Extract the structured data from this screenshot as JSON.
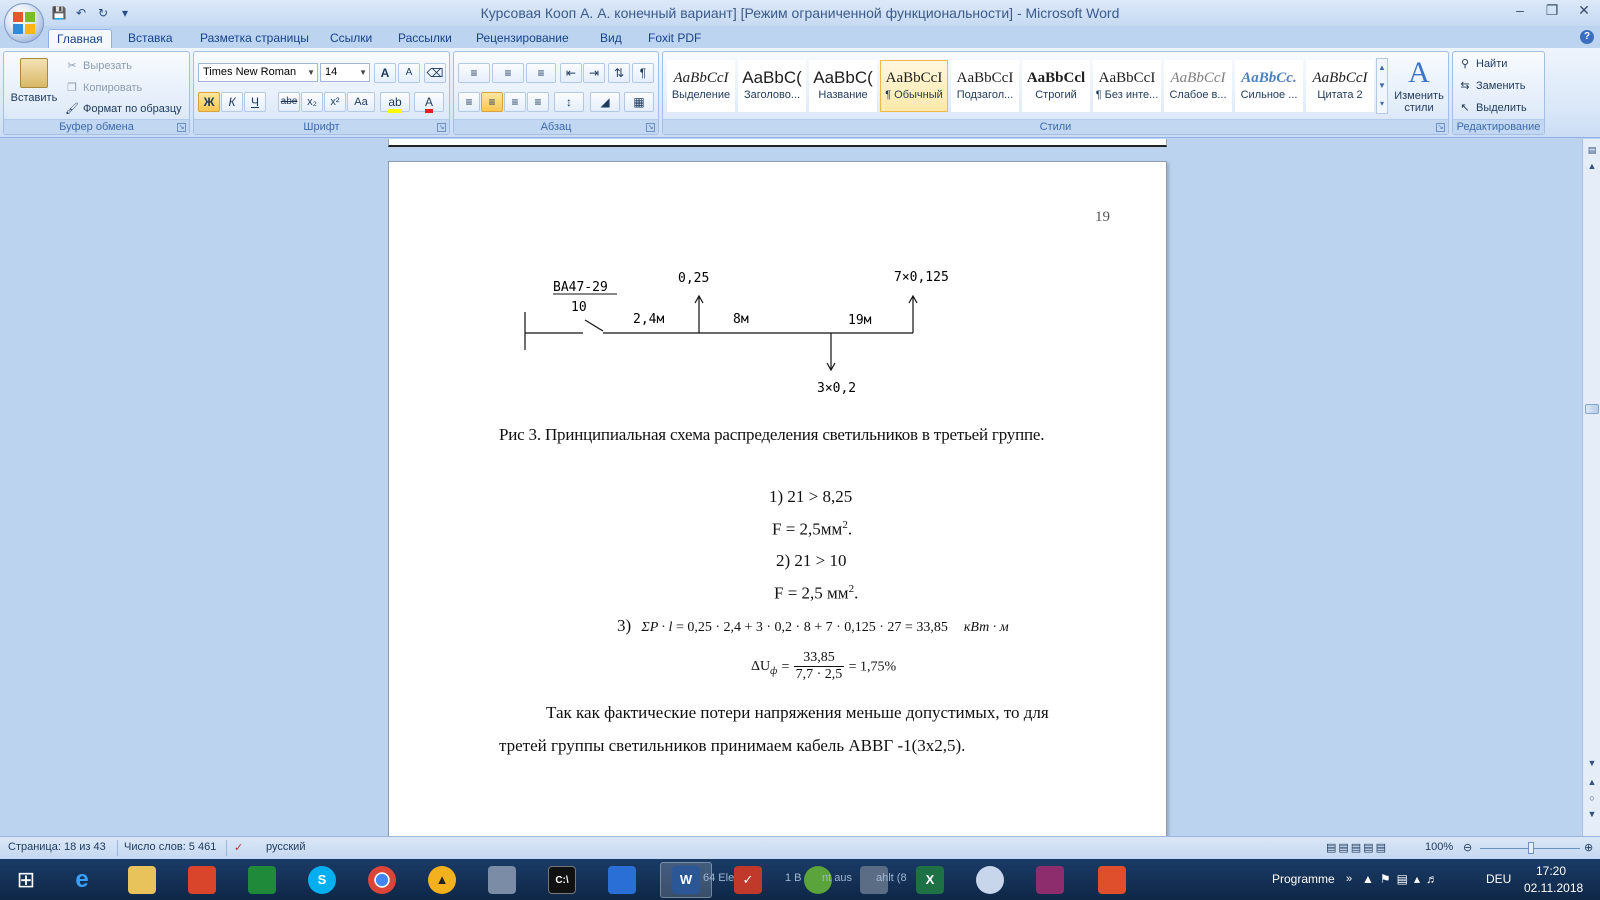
{
  "window": {
    "title": "Курсовая Кооп А. А. конечный вариант] [Режим ограниченной функциональности] - Microsoft Word"
  },
  "qat": {
    "save_icon": "save-icon",
    "undo_icon": "undo-icon",
    "redo_icon": "redo-icon",
    "customize_icon": "chevron-down-icon"
  },
  "tabs": [
    {
      "label": "Главная"
    },
    {
      "label": "Вставка"
    },
    {
      "label": "Разметка страницы"
    },
    {
      "label": "Ссылки"
    },
    {
      "label": "Рассылки"
    },
    {
      "label": "Рецензирование"
    },
    {
      "label": "Вид"
    },
    {
      "label": "Foxit PDF"
    }
  ],
  "clipboard": {
    "group_label": "Буфер обмена",
    "paste": "Вставить",
    "cut": "Вырезать",
    "copy": "Копировать",
    "format_painter": "Формат по образцу"
  },
  "font": {
    "group_label": "Шрифт",
    "font_name": "Times New Roman",
    "font_size": "14",
    "bold": "Ж",
    "italic": "К",
    "underline": "Ч",
    "strike": "abe",
    "subscript": "x₂",
    "superscript": "x²",
    "case": "Аа",
    "grow": "A",
    "shrink": "A"
  },
  "paragraph": {
    "group_label": "Абзац"
  },
  "styles": {
    "group_label": "Стили",
    "change_styles": "Изменить стили",
    "items": [
      {
        "sample": "AaBbCcI",
        "name": "Выделение"
      },
      {
        "sample": "AaBbC(",
        "name": "Заголово..."
      },
      {
        "sample": "AaBbC(",
        "name": "Название"
      },
      {
        "sample": "AaBbCcI",
        "name": "¶ Обычный"
      },
      {
        "sample": "AaBbCcI",
        "name": "Подзагол..."
      },
      {
        "sample": "AaBbCcl",
        "name": "Строгий"
      },
      {
        "sample": "AaBbCcI",
        "name": "¶ Без инте..."
      },
      {
        "sample": "AaBbCcI",
        "name": "Слабое в..."
      },
      {
        "sample": "AaBbCc.",
        "name": "Сильное ..."
      },
      {
        "sample": "AaBbCcI",
        "name": "Цитата 2"
      }
    ]
  },
  "editing": {
    "group_label": "Редактирование",
    "find": "Найти",
    "replace": "Заменить",
    "select": "Выделить"
  },
  "document": {
    "page_number": "19",
    "diagram": {
      "breaker_label": "ВА47-29",
      "breaker_rating": "10",
      "load1": "0,25",
      "load2": "7×0,125",
      "load3": "3×0,2",
      "seg1": "2,4м",
      "seg2": "8м",
      "seg3": "19м"
    },
    "caption": "Рис 3.  Принципиальная схема распределения светильников в третьей группе.",
    "eq1": "1) 21 > 8,25",
    "eq2_text": "F = 2,5мм",
    "eq3": "2) 21 > 10",
    "eq4_text": "F = 2,5 мм",
    "superscript_2": "2",
    "period": ".",
    "eq5_prefix": "3)",
    "eq5_sum": "ΣP · l",
    "eq5_body": " = 0,25 · 2,4 + 3 · 0,2 · 8 + 7 · 0,125 · 27 = 33,85",
    "eq5_unit": "кВт · м",
    "eq6_lhs": "ΔU",
    "eq6_sub": "ф",
    "eq6_eq": "=",
    "eq6_num": "33,85",
    "eq6_den": "7,7 · 2,5",
    "eq6_result": "= 1,75%",
    "para_line1": "Так как фактические потери напряжения меньше допустимых, то для",
    "para_line2": "третей группы светильников принимаем кабель АВВГ -1(3х2,5)."
  },
  "statusbar": {
    "page": "Страница: 18 из 43",
    "words": "Число слов: 5 461",
    "language": "русский",
    "zoom": "100%"
  },
  "taskbar": {
    "tray_label": "Programme",
    "lang": "DEU",
    "time": "17:20",
    "date": "02.11.2018",
    "partial_text1": "64 Ele",
    "partial_text2": "1 B",
    "partial_text3": "nt aus",
    "partial_text4": "ahlt (8"
  }
}
